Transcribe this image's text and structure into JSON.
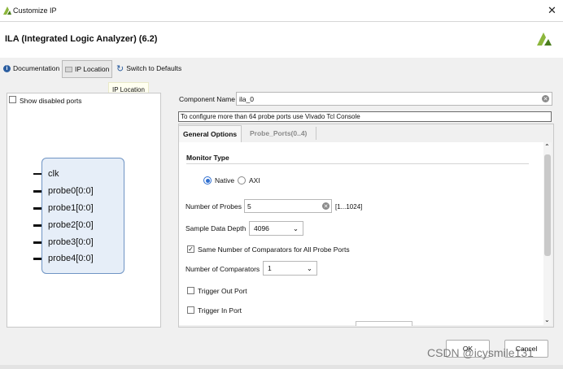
{
  "window": {
    "title": "Customize IP",
    "close_icon": "close-icon"
  },
  "header": {
    "title": "ILA (Integrated Logic Analyzer) (6.2)"
  },
  "toolbar": {
    "documentation": "Documentation",
    "ip_location": "IP Location",
    "switch_defaults": "Switch to Defaults",
    "tooltip": "IP Location"
  },
  "left": {
    "show_disabled_ports": "Show disabled ports",
    "ports": [
      "clk",
      "probe0[0:0]",
      "probe1[0:0]",
      "probe2[0:0]",
      "probe3[0:0]",
      "probe4[0:0]"
    ]
  },
  "right": {
    "component_name_label": "Component Name",
    "component_name_value": "ila_0",
    "info": "To configure more than 64 probe ports use Vivado Tcl Console",
    "tabs": [
      "General Options",
      "Probe_Ports(0..4)"
    ],
    "monitor_type": {
      "heading": "Monitor Type",
      "options": [
        "Native",
        "AXI"
      ],
      "selected": "Native"
    },
    "number_of_probes": {
      "label": "Number of Probes",
      "value": "5",
      "range": "[1...1024]"
    },
    "sample_data_depth": {
      "label": "Sample Data Depth",
      "value": "4096"
    },
    "same_comparators": {
      "label": "Same Number of Comparators for All Probe Ports",
      "checked": true
    },
    "number_of_comparators": {
      "label": "Number of Comparators",
      "value": "1"
    },
    "trigger_out": {
      "label": "Trigger Out Port",
      "checked": false
    },
    "trigger_in": {
      "label": "Trigger In Port",
      "checked": false
    }
  },
  "buttons": {
    "ok": "OK",
    "cancel": "Cancel"
  },
  "watermark": "CSDN @icysmile131",
  "colors": {
    "accent": "#2f6fd0",
    "block_fill": "#e6eef8",
    "block_border": "#6f94c4",
    "logo": "#8cb63c"
  }
}
